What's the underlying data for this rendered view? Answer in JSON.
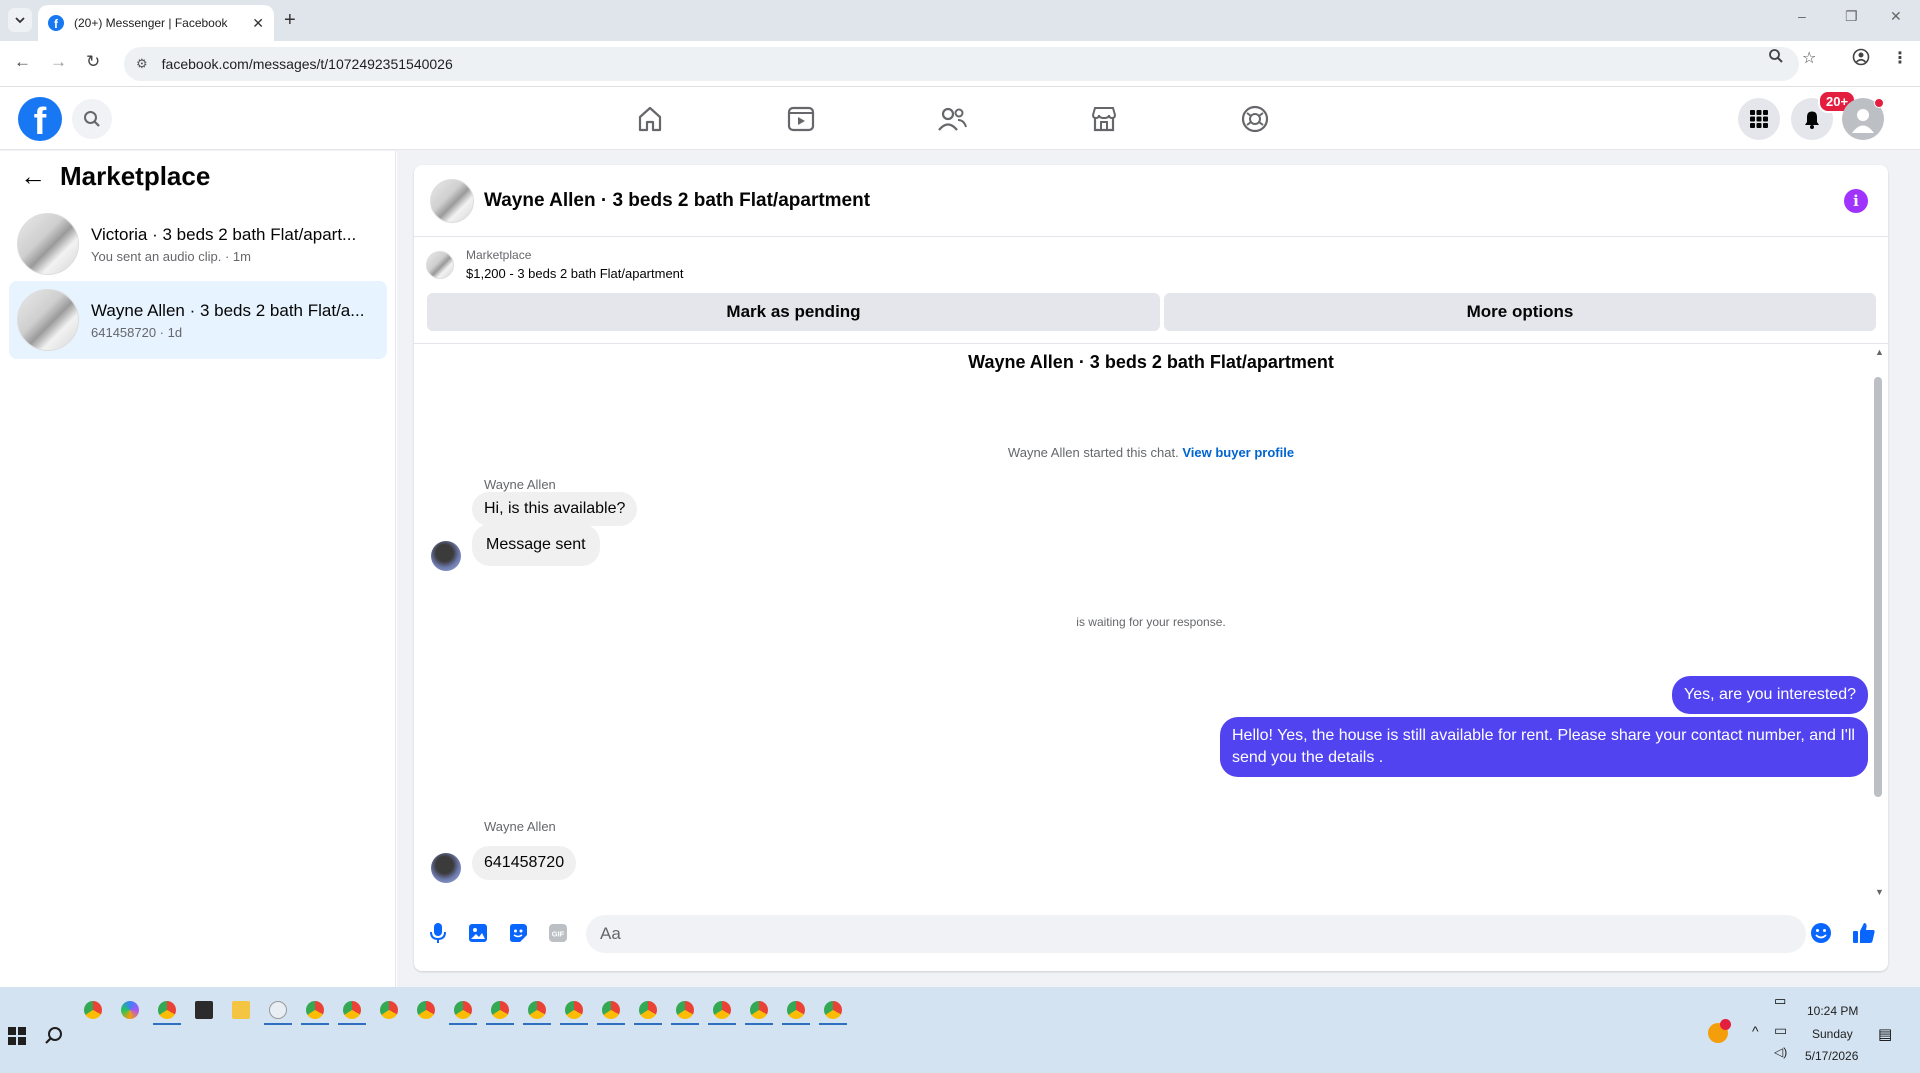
{
  "browser": {
    "tab_title": "(20+) Messenger | Facebook",
    "url": "facebook.com/messages/t/1072492351540026",
    "window_controls": [
      "–",
      "❐",
      "✕"
    ]
  },
  "header": {
    "notification_badge": "20+",
    "nav_items": [
      "home-icon",
      "video-icon",
      "friends-icon",
      "marketplace-icon",
      "gaming-icon"
    ]
  },
  "sidebar": {
    "title": "Marketplace",
    "items": [
      {
        "name": "Victoria · 3 beds 2 bath Flat/apart...",
        "sub": "You sent an audio clip. · 1m"
      },
      {
        "name": "Wayne Allen · 3 beds 2 bath Flat/a...",
        "sub": "641458720 · 1d"
      }
    ]
  },
  "chat": {
    "header_title": "Wayne Allen · 3 beds 2 bath Flat/apartment",
    "listing_source": "Marketplace",
    "listing_price": "$1,200 - 3 beds 2 bath Flat/apartment",
    "mark_pending_label": "Mark as pending",
    "more_options_label": "More options",
    "conversation_title": "Wayne Allen · 3 beds 2 bath Flat/apartment",
    "started_text": "Wayne Allen started this chat.",
    "view_profile_link": "View buyer profile",
    "waiting_text": "is waiting for your response.",
    "messages": [
      {
        "sender": "Wayne Allen",
        "text": "Hi, is this available?"
      },
      {
        "text": "Message sent"
      },
      {
        "text": "Yes, are you interested?"
      },
      {
        "text": "Hello! Yes, the house is still available for rent. Please share your contact number, and I'll send you the details ."
      },
      {
        "sender": "Wayne Allen",
        "text": "641458720"
      }
    ],
    "composer_placeholder": "Aa"
  },
  "taskbar": {
    "time": "10:24 PM",
    "day": "Sunday",
    "date": "5/17/2026"
  },
  "colors": {
    "brand": "#1877f2",
    "outgoing_bubble": "#5143f0",
    "info_icon": "#a033ff"
  }
}
